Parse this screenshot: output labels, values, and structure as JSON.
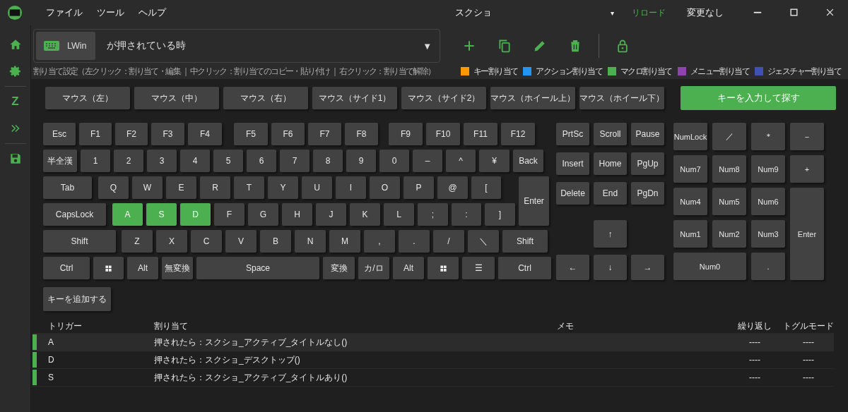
{
  "menu": [
    "ファイル",
    "ツール",
    "ヘルプ"
  ],
  "title": "スクショ",
  "title_caret": "▾",
  "reload": "リロード",
  "status": "変更なし",
  "sidebar": {
    "items": [
      {
        "kind": "home"
      },
      {
        "kind": "settings"
      },
      {
        "kind": "text",
        "label": "Z"
      },
      {
        "kind": "expand"
      },
      {
        "kind": "save"
      }
    ]
  },
  "trigger": {
    "key": "LWin",
    "condition": "が押されている時",
    "caret": "▼"
  },
  "toolbar": [
    {
      "kind": "add"
    },
    {
      "kind": "copy"
    },
    {
      "kind": "edit"
    },
    {
      "kind": "delete"
    },
    {
      "kind": "lock"
    }
  ],
  "hint": "割り当て設定（左クリック：割り当て・編集 ｜ 中クリック：割り当てのコピー・貼り付け ｜ 右クリック：割り当て解除）",
  "legend": [
    {
      "label": "キー割り当て",
      "color": "#ff9800"
    },
    {
      "label": "アクション割り当て",
      "color": "#2196f3"
    },
    {
      "label": "マクロ割り当て",
      "color": "#4caf50"
    },
    {
      "label": "メニュー割り当て",
      "color": "#8e44ad"
    },
    {
      "label": "ジェスチャー割り当て",
      "color": "#3f51b5"
    }
  ],
  "mouse_buttons": [
    "マウス（左）",
    "マウス（中）",
    "マウス（右）",
    "マウス（サイド1）",
    "マウス（サイド2）",
    "マウス（ホイール上）",
    "マウス（ホイール下）"
  ],
  "search_button": "キーを入力して探す",
  "keyboard": {
    "main_rows": [
      [
        {
          "kind": "key",
          "label": "Esc",
          "assigned": false
        },
        {
          "kind": "key",
          "label": "F1",
          "assigned": false
        },
        {
          "kind": "key",
          "label": "F2",
          "assigned": false
        },
        {
          "kind": "key",
          "label": "F3",
          "assigned": false
        },
        {
          "kind": "key",
          "label": "F4",
          "assigned": false
        },
        {
          "kind": "key",
          "label": "F5",
          "assigned": false
        },
        {
          "kind": "key",
          "label": "F6",
          "assigned": false
        },
        {
          "kind": "key",
          "label": "F7",
          "assigned": false
        },
        {
          "kind": "key",
          "label": "F8",
          "assigned": false
        },
        {
          "kind": "key",
          "label": "F9",
          "assigned": false
        },
        {
          "kind": "key",
          "label": "F10",
          "assigned": false
        },
        {
          "kind": "key",
          "label": "F11",
          "assigned": false
        },
        {
          "kind": "key",
          "label": "F12",
          "assigned": false
        }
      ],
      [
        {
          "kind": "key",
          "label": "半全漢",
          "assigned": false
        },
        {
          "kind": "key",
          "label": "1",
          "assigned": false
        },
        {
          "kind": "key",
          "label": "2",
          "assigned": false
        },
        {
          "kind": "key",
          "label": "3",
          "assigned": false
        },
        {
          "kind": "key",
          "label": "4",
          "assigned": false
        },
        {
          "kind": "key",
          "label": "5",
          "assigned": false
        },
        {
          "kind": "key",
          "label": "6",
          "assigned": false
        },
        {
          "kind": "key",
          "label": "7",
          "assigned": false
        },
        {
          "kind": "key",
          "label": "8",
          "assigned": false
        },
        {
          "kind": "key",
          "label": "9",
          "assigned": false
        },
        {
          "kind": "key",
          "label": "0",
          "assigned": false
        },
        {
          "kind": "key",
          "label": "–",
          "assigned": false
        },
        {
          "kind": "key",
          "label": "^",
          "assigned": false
        },
        {
          "kind": "key",
          "label": "¥",
          "assigned": false
        },
        {
          "kind": "key",
          "label": "Back",
          "assigned": false
        }
      ],
      [
        {
          "kind": "key",
          "label": "Tab",
          "assigned": false
        },
        {
          "kind": "key",
          "label": "Q",
          "assigned": false
        },
        {
          "kind": "key",
          "label": "W",
          "assigned": false
        },
        {
          "kind": "key",
          "label": "E",
          "assigned": false
        },
        {
          "kind": "key",
          "label": "R",
          "assigned": false
        },
        {
          "kind": "key",
          "label": "T",
          "assigned": false
        },
        {
          "kind": "key",
          "label": "Y",
          "assigned": false
        },
        {
          "kind": "key",
          "label": "U",
          "assigned": false
        },
        {
          "kind": "key",
          "label": "I",
          "assigned": false
        },
        {
          "kind": "key",
          "label": "O",
          "assigned": false
        },
        {
          "kind": "key",
          "label": "P",
          "assigned": false
        },
        {
          "kind": "key",
          "label": "@",
          "assigned": false
        },
        {
          "kind": "key",
          "label": "[",
          "assigned": false
        },
        {
          "kind": "tall",
          "label": "Enter",
          "assigned": false
        }
      ],
      [
        {
          "kind": "key",
          "label": "CapsLock",
          "assigned": false
        },
        {
          "kind": "key",
          "label": "A",
          "assigned": true
        },
        {
          "kind": "key",
          "label": "S",
          "assigned": true
        },
        {
          "kind": "key",
          "label": "D",
          "assigned": true
        },
        {
          "kind": "key",
          "label": "F",
          "assigned": false
        },
        {
          "kind": "key",
          "label": "G",
          "assigned": false
        },
        {
          "kind": "key",
          "label": "H",
          "assigned": false
        },
        {
          "kind": "key",
          "label": "J",
          "assigned": false
        },
        {
          "kind": "key",
          "label": "K",
          "assigned": false
        },
        {
          "kind": "key",
          "label": "L",
          "assigned": false
        },
        {
          "kind": "key",
          "label": ";",
          "assigned": false
        },
        {
          "kind": "key",
          "label": ":",
          "assigned": false
        },
        {
          "kind": "key",
          "label": "]",
          "assigned": false
        }
      ],
      [
        {
          "kind": "key",
          "label": "Shift",
          "assigned": false
        },
        {
          "kind": "key",
          "label": "Z",
          "assigned": false
        },
        {
          "kind": "key",
          "label": "X",
          "assigned": false
        },
        {
          "kind": "key",
          "label": "C",
          "assigned": false
        },
        {
          "kind": "key",
          "label": "V",
          "assigned": false
        },
        {
          "kind": "key",
          "label": "B",
          "assigned": false
        },
        {
          "kind": "key",
          "label": "N",
          "assigned": false
        },
        {
          "kind": "key",
          "label": "M",
          "assigned": false
        },
        {
          "kind": "key",
          "label": ",",
          "assigned": false
        },
        {
          "kind": "key",
          "label": ".",
          "assigned": false
        },
        {
          "kind": "key",
          "label": "/",
          "assigned": false
        },
        {
          "kind": "key",
          "label": "＼",
          "assigned": false
        },
        {
          "kind": "key",
          "label": "Shift",
          "assigned": false
        }
      ],
      [
        {
          "kind": "key",
          "label": "Ctrl",
          "assigned": false
        },
        {
          "kind": "windows",
          "assigned": false
        },
        {
          "kind": "key",
          "label": "Alt",
          "assigned": false
        },
        {
          "kind": "key",
          "label": "無変換",
          "assigned": false
        },
        {
          "kind": "key",
          "label": "Space",
          "assigned": false
        },
        {
          "kind": "key",
          "label": "変換",
          "assigned": false
        },
        {
          "kind": "key",
          "label": "カ/ロ",
          "assigned": false
        },
        {
          "kind": "key",
          "label": "Alt",
          "assigned": false
        },
        {
          "kind": "windows",
          "assigned": false
        },
        {
          "kind": "key",
          "label": "☰",
          "assigned": false
        },
        {
          "kind": "key",
          "label": "Ctrl",
          "assigned": false
        }
      ]
    ],
    "nav_keys": [
      {
        "kind": "key",
        "label": "PrtSc",
        "assigned": false
      },
      {
        "kind": "key",
        "label": "Scroll",
        "assigned": false
      },
      {
        "kind": "key",
        "label": "Pause",
        "assigned": false
      },
      {
        "kind": "key",
        "label": "Insert",
        "assigned": false
      },
      {
        "kind": "key",
        "label": "Home",
        "assigned": false
      },
      {
        "kind": "key",
        "label": "PgUp",
        "assigned": false
      },
      {
        "kind": "key",
        "label": "Delete",
        "assigned": false
      },
      {
        "kind": "key",
        "label": "End",
        "assigned": false
      },
      {
        "kind": "key",
        "label": "PgDn",
        "assigned": false
      },
      {
        "kind": "key",
        "label": "↑",
        "assigned": false
      },
      {
        "kind": "key",
        "label": "←",
        "assigned": false
      },
      {
        "kind": "key",
        "label": "↓",
        "assigned": false
      },
      {
        "kind": "key",
        "label": "→",
        "assigned": false
      }
    ],
    "numpad": [
      {
        "kind": "key",
        "label": "NumLock",
        "assigned": false
      },
      {
        "kind": "key",
        "label": "／",
        "assigned": false
      },
      {
        "kind": "key",
        "label": "＊",
        "assigned": false
      },
      {
        "kind": "key",
        "label": "−",
        "assigned": false
      },
      {
        "kind": "key",
        "label": "Num7",
        "assigned": false
      },
      {
        "kind": "key",
        "label": "Num8",
        "assigned": false
      },
      {
        "kind": "key",
        "label": "Num9",
        "assigned": false
      },
      {
        "kind": "key",
        "label": "+",
        "assigned": false
      },
      {
        "kind": "key",
        "label": "Num4",
        "assigned": false
      },
      {
        "kind": "key",
        "label": "Num5",
        "assigned": false
      },
      {
        "kind": "key",
        "label": "Num6",
        "assigned": false
      },
      {
        "kind": "key",
        "label": "Num1",
        "assigned": false
      },
      {
        "kind": "key",
        "label": "Num2",
        "assigned": false
      },
      {
        "kind": "key",
        "label": "Num3",
        "assigned": false
      },
      {
        "kind": "tall",
        "label": "Enter",
        "assigned": false
      },
      {
        "kind": "wide",
        "label": "Num0",
        "assigned": false
      },
      {
        "kind": "key",
        "label": ".",
        "assigned": false
      }
    ]
  },
  "add_key_button": "キーを追加する",
  "table": {
    "columns": [
      "トリガー",
      "割り当て",
      "メモ",
      "繰り返し",
      "トグルモード"
    ],
    "rows": [
      {
        "trigger": "A",
        "assignment": "押されたら：スクショ_アクティブ_タイトルなし()",
        "repeat": "----",
        "toggle": "----",
        "color": "#4caf50"
      },
      {
        "trigger": "D",
        "assignment": "押されたら：スクショ_デスクトップ()",
        "repeat": "----",
        "toggle": "----",
        "color": "#4caf50"
      },
      {
        "trigger": "S",
        "assignment": "押されたら：スクショ_アクティブ_タイトルあり()",
        "repeat": "----",
        "toggle": "----",
        "color": "#4caf50"
      }
    ]
  }
}
